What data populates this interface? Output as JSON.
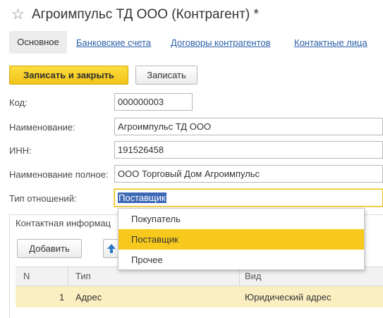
{
  "window": {
    "title": "Агроимпульс ТД ООО (Контрагент) *"
  },
  "tabs": [
    {
      "label": "Основное"
    },
    {
      "label": "Банковские счета"
    },
    {
      "label": "Договоры контрагентов"
    },
    {
      "label": "Контактные лица"
    }
  ],
  "toolbar": {
    "save_close_label": "Записать и закрыть",
    "save_label": "Записать"
  },
  "form": {
    "code": {
      "label": "Код:",
      "value": "000000003"
    },
    "name": {
      "label": "Наименование:",
      "value": "Агроимпульс ТД ООО"
    },
    "inn": {
      "label": "ИНН:",
      "value": "191526458"
    },
    "full_name": {
      "label": "Наименование полное:",
      "value": "ООО Торговый Дом Агроимпульс"
    },
    "relation_type": {
      "label": "Тип отношений:",
      "value": "Поставщик"
    }
  },
  "contact_info": {
    "title": "Контактная информац",
    "add_label": "Добавить",
    "columns": [
      "N",
      "Тип",
      "Вид"
    ],
    "rows": [
      {
        "n": "1",
        "type": "Адрес",
        "kind": "Юридический адрес"
      }
    ]
  },
  "dropdown": {
    "options": [
      "Покупатель",
      "Поставщик",
      "Прочее"
    ],
    "selected": "Поставщик"
  },
  "colors": {
    "accent_yellow": "#f6c91c",
    "link_blue": "#2a5fa8",
    "selection_blue": "#3e69b7",
    "row_highlight": "#fbefc2"
  }
}
